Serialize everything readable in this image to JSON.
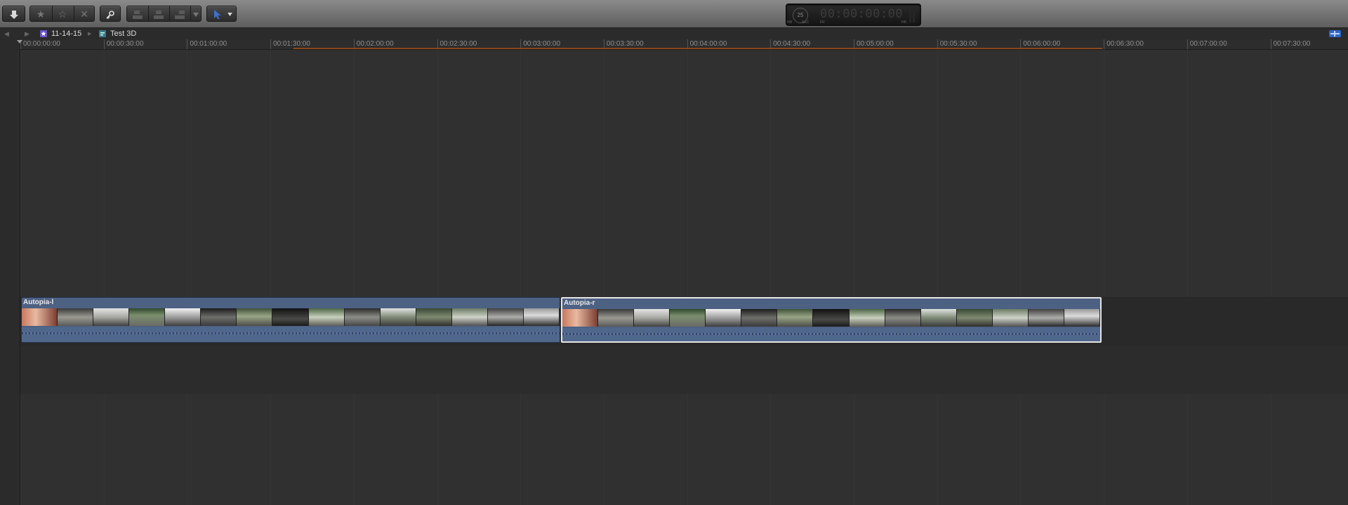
{
  "toolbar": {
    "import_icon": "down-arrow-icon",
    "rating": [
      "favorite-star-icon",
      "unrate-star-icon",
      "reject-x-icon"
    ],
    "keyword_icon": "key-icon",
    "edit_buttons": [
      "connect-clip-icon",
      "insert-clip-icon",
      "append-clip-icon"
    ],
    "tool_icon": "select-arrow-icon",
    "tool_color": "#3f6fd1"
  },
  "timecode": {
    "value": "00:00:00:00",
    "rate": "25",
    "labels": [
      "HR",
      "SEC",
      "FR",
      "HR"
    ]
  },
  "breadcrumb": {
    "items": [
      {
        "label": "11-14-15",
        "icon": "event-star-icon"
      },
      {
        "label": "Test 3D",
        "icon": "project-icon"
      }
    ]
  },
  "ruler": {
    "ticks": [
      "00:00:00:00",
      "00:00:30:00",
      "00:01:00:00",
      "00:01:30:00",
      "00:02:00:00",
      "00:02:30:00",
      "00:03:00:00",
      "00:03:30:00",
      "00:04:00:00",
      "00:04:30:00",
      "00:05:00:00",
      "00:05:30:00",
      "00:06:00:00",
      "00:06:30:00",
      "00:07:00:00",
      "00:07:30:00"
    ],
    "range_color": "#8a4a1e"
  },
  "clips": [
    {
      "name": "Autopia-l",
      "selected": false
    },
    {
      "name": "Autopia-r",
      "selected": true
    }
  ],
  "colors": {
    "clip": "#4d6183",
    "selection": "#e6e6e6"
  }
}
